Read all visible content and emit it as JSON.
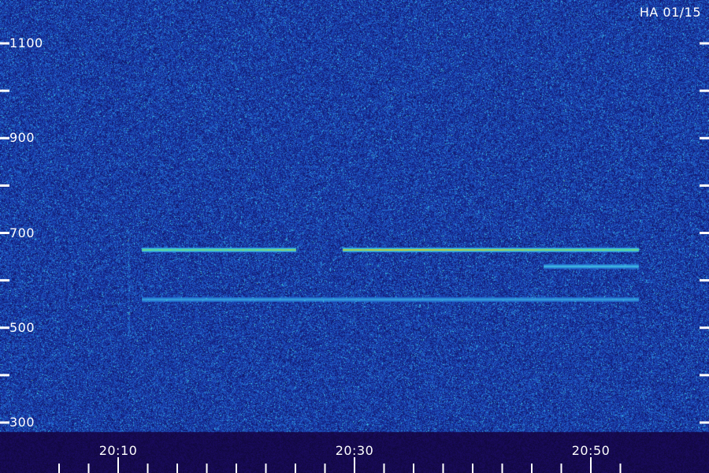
{
  "stamp": "HA 01/15",
  "colors": {
    "background_noise": "#16248c",
    "bright_noise": "#3fc0e6",
    "signal_low": "#28d8c8",
    "signal_high": "#d8c020",
    "bottom_band": "#160a48",
    "tick": "#ffffff"
  },
  "chart_data": {
    "type": "heatmap",
    "title": "",
    "xlabel": "",
    "ylabel": "",
    "x_tick_labels": [
      "20:10",
      "20:30",
      "20:50"
    ],
    "x_ticks_minutes": [
      20.25,
      20.5,
      20.75
    ],
    "x_minor_tick_interval_minutes": 2.5,
    "xlim": [
      "20:04",
      "20:54"
    ],
    "y_tick_labels": [
      "300",
      "500",
      "700",
      "900",
      "1100"
    ],
    "y_ticks": [
      300,
      500,
      700,
      900,
      1100
    ],
    "y_minor_tick_interval": 100,
    "ylim": [
      280,
      1120
    ],
    "features": [
      {
        "name": "",
        "frequency": 665,
        "time_segments": [
          [
            "20:12",
            "20:25"
          ],
          [
            "20:29",
            "20:54"
          ]
        ],
        "peak_time": "20:35",
        "intensity": 0.9
      },
      {
        "name": "",
        "frequency": 630,
        "time_segments": [
          [
            "20:46",
            "20:54"
          ]
        ],
        "intensity": 0.35
      },
      {
        "name": "",
        "frequency": 560,
        "time_segments": [
          [
            "20:12",
            "20:54"
          ]
        ],
        "intensity": 0.25
      }
    ],
    "grid": false,
    "legend": "none"
  }
}
